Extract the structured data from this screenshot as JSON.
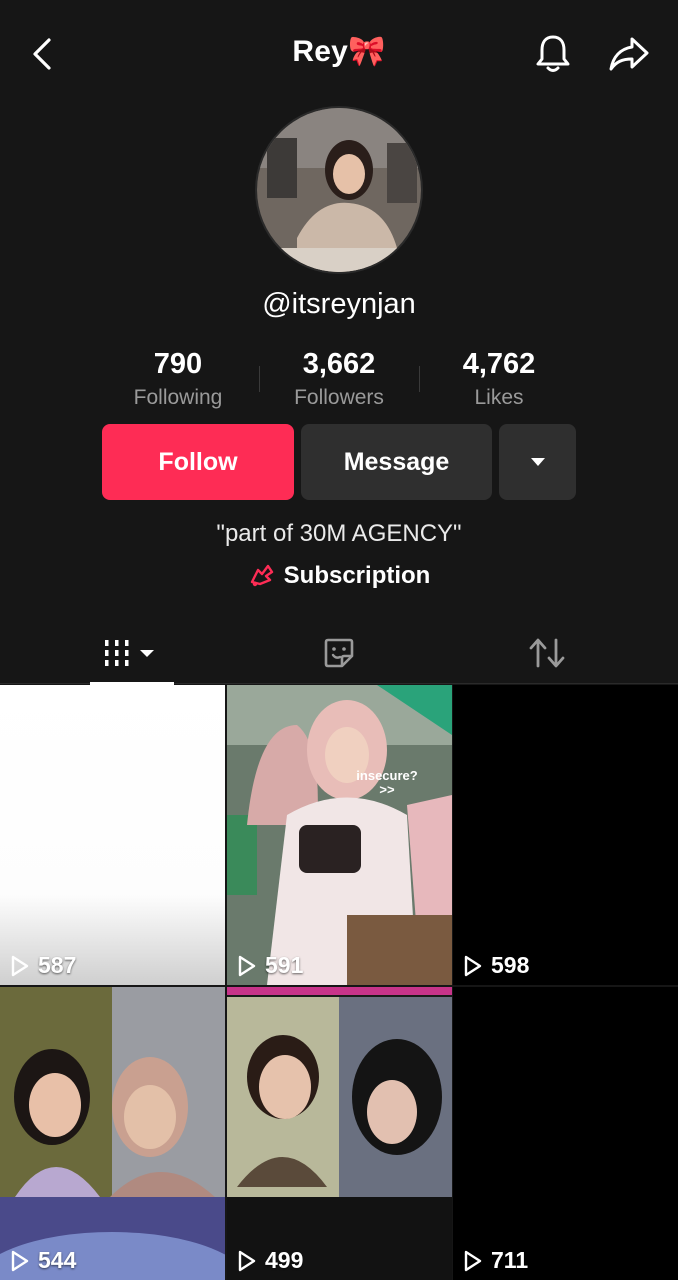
{
  "header": {
    "title": "Rey🎀"
  },
  "profile": {
    "handle": "@itsreynjan",
    "bio": "\"part of 30M  AGENCY\"",
    "subscription_label": "Subscription"
  },
  "stats": [
    {
      "value": "790",
      "label": "Following"
    },
    {
      "value": "3,662",
      "label": "Followers"
    },
    {
      "value": "4,762",
      "label": "Likes"
    }
  ],
  "actions": {
    "follow_label": "Follow",
    "message_label": "Message"
  },
  "tabs": {
    "icons": [
      "videos-grid-icon",
      "sticker-icon",
      "repost-icon"
    ]
  },
  "videos": [
    {
      "views": "587"
    },
    {
      "views": "591",
      "caption": "insecure?\n>>"
    },
    {
      "views": "598"
    },
    {
      "views": "544"
    },
    {
      "views": "499"
    },
    {
      "views": "711"
    }
  ],
  "colors": {
    "background": "#161616",
    "follow_button": "#fe2c55",
    "secondary_button": "#2f2f2f",
    "muted_text": "#9a9a9a"
  }
}
